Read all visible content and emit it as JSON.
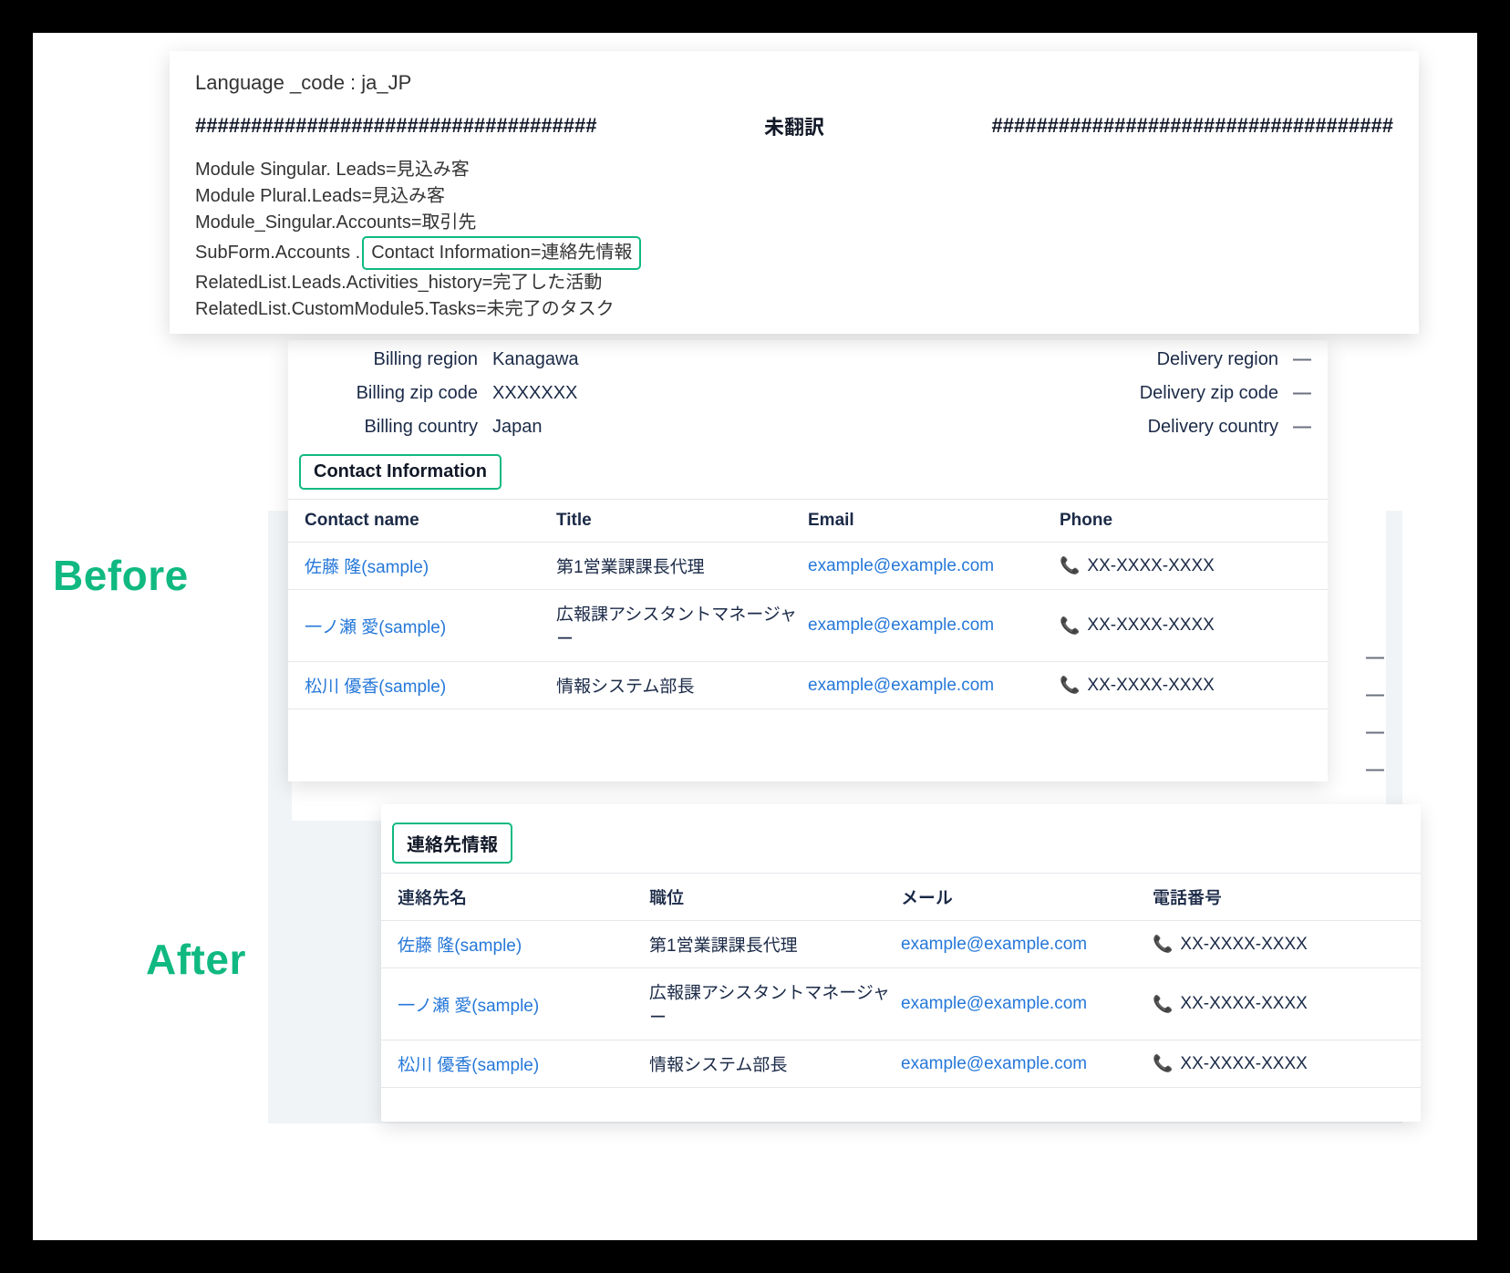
{
  "labels": {
    "before": "Before",
    "after": "After"
  },
  "code_card": {
    "lang_line": "Language _code : ja_JP",
    "hashes_left": "####################################",
    "center": "未翻訳",
    "hashes_right": "####################################",
    "lines": {
      "l1": "Module Singular. Leads=見込み客",
      "l2": "Module Plural.Leads=見込み客",
      "l3": "Module_Singular.Accounts=取引先",
      "l4_prefix": "SubForm.Accounts . ",
      "l4_hl": "Contact Information=連絡先情報",
      "l5": "RelatedList.Leads.Activities_history=完了した活動",
      "l6": "RelatedList.CustomModule5.Tasks=未完了のタスク"
    }
  },
  "before": {
    "fields_left": [
      {
        "label": "Billing region",
        "value": "Kanagawa"
      },
      {
        "label": "Billing zip code",
        "value": "XXXXXXX"
      },
      {
        "label": "Billing country",
        "value": "Japan"
      }
    ],
    "fields_right": [
      {
        "label": "Delivery region",
        "value": "—"
      },
      {
        "label": "Delivery zip code",
        "value": "—"
      },
      {
        "label": "Delivery country",
        "value": "—"
      }
    ],
    "section_title": "Contact Information",
    "columns": {
      "c1": "Contact name",
      "c2": "Title",
      "c3": "Email",
      "c4": "Phone"
    },
    "rows": [
      {
        "name": "佐藤 隆(sample)",
        "title": "第1営業課課長代理",
        "email": "example@example.com",
        "phone": "XX-XXXX-XXXX"
      },
      {
        "name": "一ノ瀬 愛(sample)",
        "title": "広報課アシスタントマネージャー",
        "email": "example@example.com",
        "phone": "XX-XXXX-XXXX"
      },
      {
        "name": "松川 優香(sample)",
        "title": "情報システム部長",
        "email": "example@example.com",
        "phone": "XX-XXXX-XXXX"
      }
    ],
    "extra_dashes": [
      "—",
      "—",
      "—",
      "—",
      "—"
    ]
  },
  "after": {
    "section_title": "連絡先情報",
    "columns": {
      "c1": "連絡先名",
      "c2": "職位",
      "c3": "メール",
      "c4": "電話番号"
    },
    "rows": [
      {
        "name": "佐藤 隆(sample)",
        "title": "第1営業課課長代理",
        "email": "example@example.com",
        "phone": "XX-XXXX-XXXX"
      },
      {
        "name": "一ノ瀬 愛(sample)",
        "title": "広報課アシスタントマネージャー",
        "email": "example@example.com",
        "phone": "XX-XXXX-XXXX"
      },
      {
        "name": "松川 優香(sample)",
        "title": "情報システム部長",
        "email": "example@example.com",
        "phone": "XX-XXXX-XXXX"
      }
    ]
  }
}
